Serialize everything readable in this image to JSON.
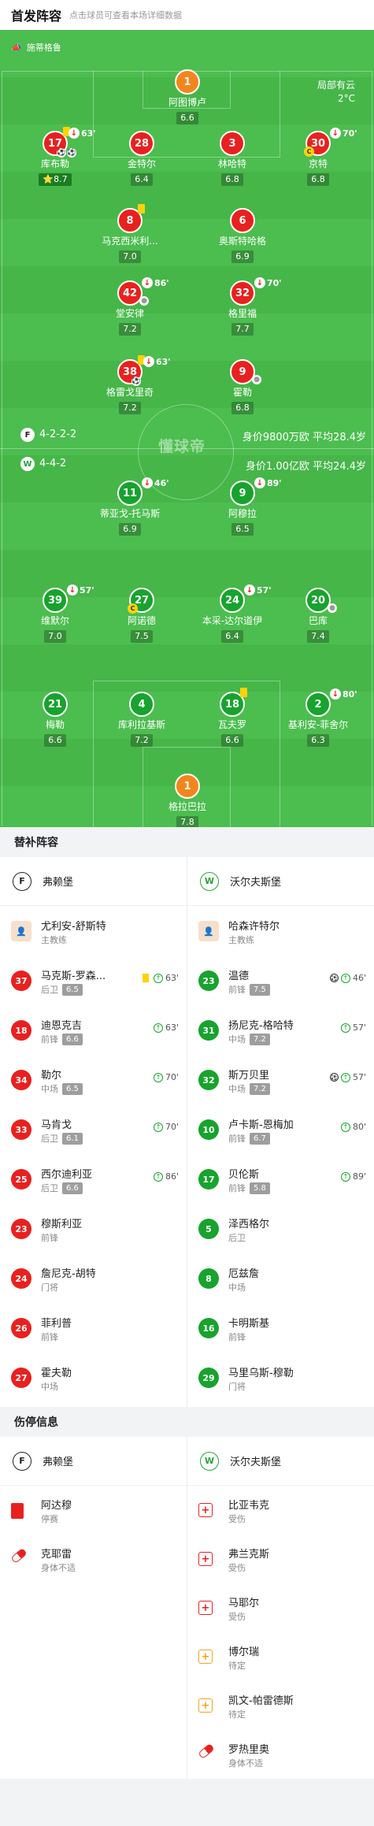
{
  "header": {
    "title": "首发阵容",
    "subtitle": "点击球员可查看本场详细数据"
  },
  "pitch": {
    "sponsor": "施蒂格鲁",
    "weather": {
      "condition": "局部有云",
      "temp": "2°C"
    },
    "watermark": "懂球帝",
    "home_formation": {
      "formation": "4-2-2-2",
      "value": "身价9800万欧 平均28.4岁"
    },
    "away_formation": {
      "formation": "4-4-2",
      "value": "身价1.00亿欧 平均24.4岁"
    },
    "home_players": [
      {
        "num": "1",
        "name": "阿图博卢",
        "rating": "6.6"
      },
      {
        "num": "17",
        "name": "库布勒",
        "rating": "8.7",
        "sub": "63'",
        "star": true
      },
      {
        "num": "28",
        "name": "金特尔",
        "rating": "6.4"
      },
      {
        "num": "3",
        "name": "林哈特",
        "rating": "6.8"
      },
      {
        "num": "30",
        "name": "京特",
        "rating": "6.8",
        "sub": "70'"
      },
      {
        "num": "8",
        "name": "马克西米利...",
        "rating": "7.0"
      },
      {
        "num": "6",
        "name": "奥斯特哈格",
        "rating": "6.9"
      },
      {
        "num": "42",
        "name": "堂安律",
        "rating": "7.2",
        "sub": "86'"
      },
      {
        "num": "32",
        "name": "格里福",
        "rating": "7.7",
        "sub": "70'"
      },
      {
        "num": "38",
        "name": "格雷戈里奇",
        "rating": "7.2",
        "sub": "63'"
      },
      {
        "num": "9",
        "name": "霍勒",
        "rating": "6.8"
      }
    ],
    "away_players": [
      {
        "num": "11",
        "name": "蒂亚戈-托马斯",
        "rating": "6.9",
        "sub": "46'"
      },
      {
        "num": "9",
        "name": "阿穆拉",
        "rating": "6.5",
        "sub": "89'"
      },
      {
        "num": "39",
        "name": "维默尔",
        "rating": "7.0",
        "sub": "57'"
      },
      {
        "num": "27",
        "name": "阿诺德",
        "rating": "7.5"
      },
      {
        "num": "24",
        "name": "本采-达尔道伊",
        "rating": "6.4",
        "sub": "57'"
      },
      {
        "num": "20",
        "name": "巴库",
        "rating": "7.4"
      },
      {
        "num": "21",
        "name": "梅勒",
        "rating": "6.6"
      },
      {
        "num": "4",
        "name": "库利拉基斯",
        "rating": "7.2"
      },
      {
        "num": "18",
        "name": "瓦夫罗",
        "rating": "6.6"
      },
      {
        "num": "2",
        "name": "基利安-菲舍尔",
        "rating": "6.3",
        "sub": "80'"
      },
      {
        "num": "1",
        "name": "格拉巴拉",
        "rating": "7.8"
      }
    ]
  },
  "subs": {
    "title": "替补阵容",
    "home_team": "弗赖堡",
    "away_team": "沃尔夫斯堡",
    "home_coach": {
      "name": "尤利安-舒斯特",
      "role": "主教练"
    },
    "away_coach": {
      "name": "哈森许特尔",
      "role": "主教练"
    },
    "home": [
      {
        "num": "37",
        "name": "马克斯-罗森...",
        "pos": "后卫",
        "rating": "6.5",
        "time": "63'"
      },
      {
        "num": "18",
        "name": "迪恩克吉",
        "pos": "前锋",
        "rating": "6.6",
        "time": "63'"
      },
      {
        "num": "34",
        "name": "勒尔",
        "pos": "中场",
        "rating": "6.5",
        "time": "70'"
      },
      {
        "num": "33",
        "name": "马肯戈",
        "pos": "后卫",
        "rating": "6.1",
        "time": "70'"
      },
      {
        "num": "25",
        "name": "西尔迪利亚",
        "pos": "后卫",
        "rating": "6.6",
        "time": "86'"
      },
      {
        "num": "23",
        "name": "穆斯利亚",
        "pos": "前锋",
        "rating": "",
        "time": ""
      },
      {
        "num": "24",
        "name": "詹尼克-胡特",
        "pos": "门将",
        "rating": "",
        "time": ""
      },
      {
        "num": "26",
        "name": "菲利普",
        "pos": "前锋",
        "rating": "",
        "time": ""
      },
      {
        "num": "27",
        "name": "霍夫勒",
        "pos": "中场",
        "rating": "",
        "time": ""
      }
    ],
    "away": [
      {
        "num": "23",
        "name": "温德",
        "pos": "前锋",
        "rating": "7.5",
        "time": "46'"
      },
      {
        "num": "31",
        "name": "扬尼克-格哈特",
        "pos": "中场",
        "rating": "7.2",
        "time": "57'"
      },
      {
        "num": "32",
        "name": "斯万贝里",
        "pos": "中场",
        "rating": "7.2",
        "time": "57'"
      },
      {
        "num": "10",
        "name": "卢卡斯-恩梅加",
        "pos": "前锋",
        "rating": "6.7",
        "time": "80'"
      },
      {
        "num": "17",
        "name": "贝伦斯",
        "pos": "前锋",
        "rating": "5.8",
        "time": "89'"
      },
      {
        "num": "5",
        "name": "泽西格尔",
        "pos": "后卫",
        "rating": "",
        "time": ""
      },
      {
        "num": "8",
        "name": "厄兹詹",
        "pos": "中场",
        "rating": "",
        "time": ""
      },
      {
        "num": "16",
        "name": "卡明斯基",
        "pos": "前锋",
        "rating": "",
        "time": ""
      },
      {
        "num": "29",
        "name": "马里乌斯-穆勒",
        "pos": "门将",
        "rating": "",
        "time": ""
      }
    ]
  },
  "injuries": {
    "title": "伤停信息",
    "home_team": "弗赖堡",
    "away_team": "沃尔夫斯堡",
    "home": [
      {
        "name": "阿达穆",
        "status": "停赛",
        "icon": "red-card"
      },
      {
        "name": "克耶雷",
        "status": "身体不适",
        "icon": "pill"
      }
    ],
    "away": [
      {
        "name": "比亚韦克",
        "status": "受伤",
        "icon": "medical-cross"
      },
      {
        "name": "弗兰克斯",
        "status": "受伤",
        "icon": "medical-cross"
      },
      {
        "name": "马耶尔",
        "status": "受伤",
        "icon": "medical-cross"
      },
      {
        "name": "博尔瑞",
        "status": "待定",
        "icon": "medical-plus"
      },
      {
        "name": "凯文-帕雷德斯",
        "status": "待定",
        "icon": "medical-plus"
      },
      {
        "name": "罗热里奥",
        "status": "身体不适",
        "icon": "pill"
      }
    ]
  }
}
